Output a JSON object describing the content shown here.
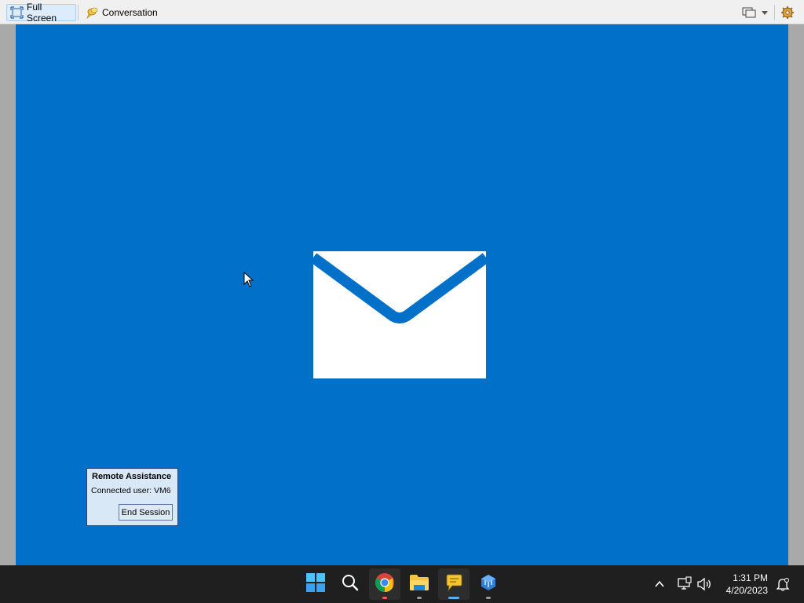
{
  "toolbar": {
    "full_screen_label": "Full Screen",
    "conversation_label": "Conversation",
    "full_screen_icon": "full-screen-icon",
    "conversation_icon": "conversation-icon",
    "screen_icon": "screen-icon",
    "dropdown_icon": "chevron-down-icon",
    "settings_icon": "settings-icon"
  },
  "remote_view": {
    "background_color": "#0170c8",
    "center_icon": "mail-icon"
  },
  "remote_assistance": {
    "title": "Remote Assistance",
    "connected_user_label": "Connected user:",
    "connected_user": "VM6",
    "end_button": "End Session"
  },
  "taskbar": {
    "apps": [
      {
        "name": "start",
        "icon": "windows-logo-icon"
      },
      {
        "name": "search",
        "icon": "search-icon"
      },
      {
        "name": "chrome",
        "icon": "chrome-icon",
        "open": true
      },
      {
        "name": "file-explorer",
        "icon": "folder-icon",
        "open": true
      },
      {
        "name": "remote-assistance",
        "icon": "chat-bubble-icon",
        "open": true,
        "active": true
      },
      {
        "name": "quick-assist",
        "icon": "app-icon",
        "open": true
      }
    ],
    "tray": {
      "overflow_icon": "chevron-up-icon",
      "network_icon": "network-icon",
      "volume_icon": "volume-icon",
      "notification_icon": "notification-icon"
    },
    "time": "1:31 PM",
    "date": "4/20/2023"
  }
}
